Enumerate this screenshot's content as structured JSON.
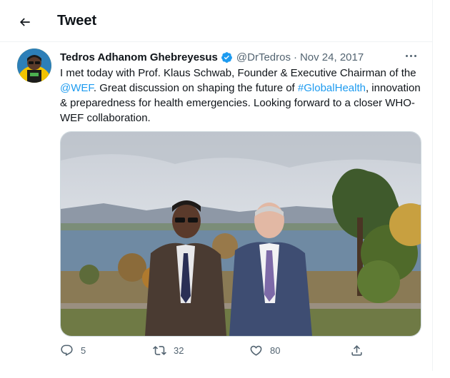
{
  "header": {
    "title": "Tweet"
  },
  "tweet": {
    "author_name": "Tedros Adhanom Ghebreyesus",
    "handle": "@DrTedros",
    "separator": "·",
    "date": "Nov 24, 2017",
    "text_part1": "I met today with Prof. Klaus Schwab, Founder & Executive Chairman of the ",
    "mention": "@WEF",
    "text_part2": ". Great discussion on shaping the future of ",
    "hashtag": "#GlobalHealth",
    "text_part3": ", innovation & preparedness for health emergencies. Looking forward to a closer WHO-WEF collaboration."
  },
  "actions": {
    "replies": "5",
    "retweets": "32",
    "likes": "80"
  },
  "icons": {
    "back": "arrow-left-icon",
    "verified": "verified-badge-icon",
    "more": "more-horizontal-icon",
    "reply": "reply-icon",
    "retweet": "retweet-icon",
    "like": "heart-icon",
    "share": "share-icon"
  },
  "colors": {
    "link": "#1d9bf0",
    "secondary_text": "#536471",
    "primary_text": "#0f1419"
  }
}
